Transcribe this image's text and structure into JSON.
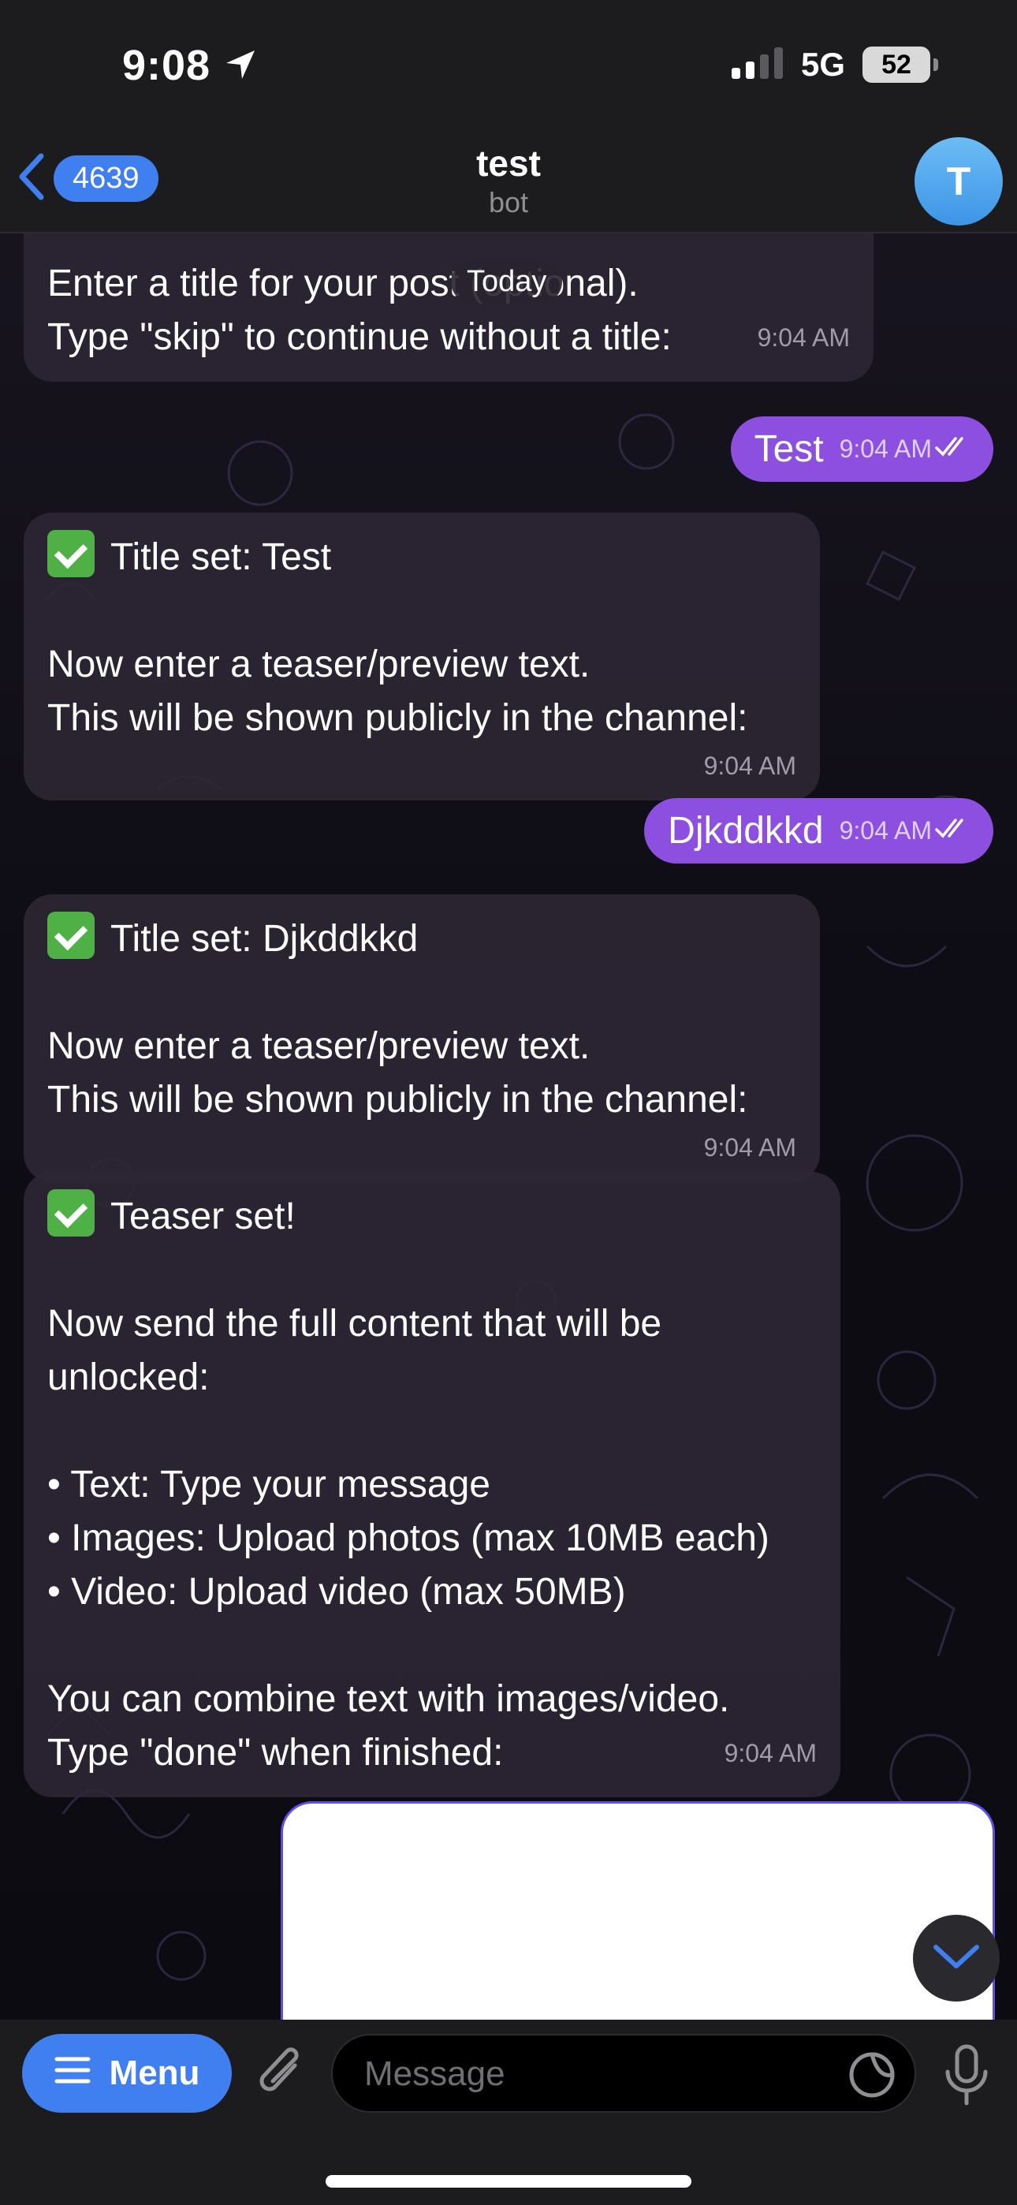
{
  "status_bar": {
    "time": "9:08",
    "network": "5G",
    "battery": "52"
  },
  "header": {
    "back_count": "4639",
    "title": "test",
    "subtitle": "bot",
    "avatar_letter": "T"
  },
  "date_separator": "Today",
  "messages": [
    {
      "id": "m1",
      "direction": "in",
      "lines": [
        "Enter a title for your post (optional).",
        "Type \"skip\" to continue without a title:"
      ],
      "time": "9:04 AM"
    },
    {
      "id": "m2",
      "direction": "out",
      "text": "Test",
      "time": "9:04 AM"
    },
    {
      "id": "m3",
      "direction": "in",
      "lines": [
        "Title set: Test",
        "",
        "Now enter a teaser/preview text.",
        "This will be shown publicly in the channel:"
      ],
      "time": "9:04 AM"
    },
    {
      "id": "m4",
      "direction": "out",
      "text": "Djkddkkd",
      "time": "9:04 AM"
    },
    {
      "id": "m5",
      "direction": "in",
      "lines": [
        "Title set: Djkddkkd",
        "",
        "Now enter a teaser/preview text.",
        "This will be shown publicly in the channel:"
      ],
      "time": "9:04 AM"
    },
    {
      "id": "m6",
      "direction": "in",
      "lines": [
        "Teaser set!",
        "",
        "Now send the full content that will be",
        "unlocked:",
        "",
        "• Text: Type your message",
        "• Images: Upload photos (max 10MB each)",
        "• Video: Upload video (max 50MB)",
        "",
        "You can combine text with images/video.",
        "Type \"done\" when finished:"
      ],
      "time": "9:04 AM"
    }
  ],
  "input_bar": {
    "menu_label": "Menu",
    "placeholder": "Message"
  },
  "colors": {
    "accent": "#3f7ff0",
    "outgoing_bubble": "#8d4fe0",
    "incoming_bubble": "#2c2634"
  },
  "icons": [
    "location-arrow-icon",
    "signal-icon",
    "back-chevron-icon",
    "check-mark-emoji-icon",
    "double-check-icon",
    "chevron-down-icon",
    "hamburger-icon",
    "paperclip-icon",
    "sticker-icon",
    "microphone-icon"
  ]
}
